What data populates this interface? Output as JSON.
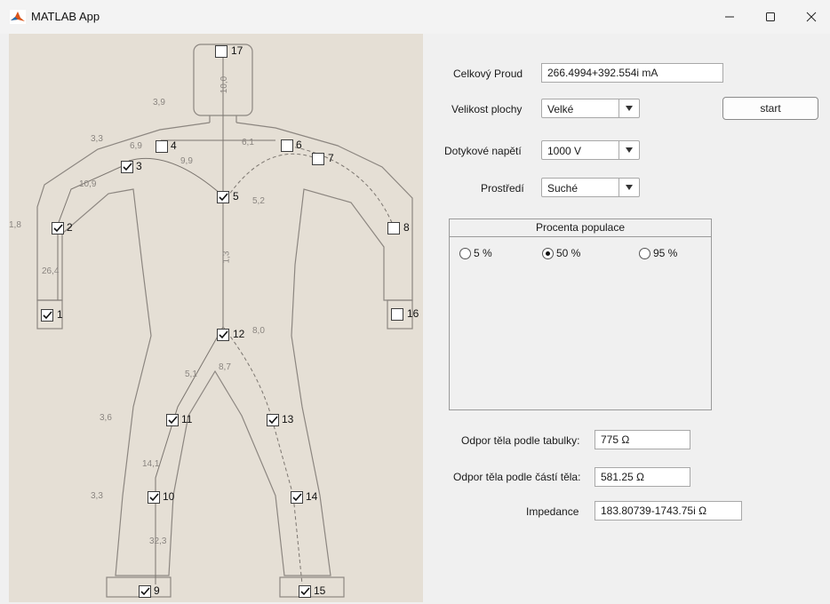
{
  "window": {
    "title": "MATLAB App",
    "minimize_icon": "minimize-icon",
    "maximize_icon": "maximize-icon",
    "close_icon": "close-icon"
  },
  "figure": {
    "checkboxes": [
      {
        "id": "1",
        "label": "1",
        "checked": true
      },
      {
        "id": "2",
        "label": "2",
        "checked": true
      },
      {
        "id": "3",
        "label": "3",
        "checked": true
      },
      {
        "id": "4",
        "label": "4",
        "checked": false
      },
      {
        "id": "5",
        "label": "5",
        "checked": true
      },
      {
        "id": "6",
        "label": "6",
        "checked": false
      },
      {
        "id": "7",
        "label": "7",
        "checked": false
      },
      {
        "id": "8",
        "label": "8",
        "checked": false
      },
      {
        "id": "9",
        "label": "9",
        "checked": true
      },
      {
        "id": "10",
        "label": "10",
        "checked": true
      },
      {
        "id": "11",
        "label": "11",
        "checked": true
      },
      {
        "id": "12",
        "label": "12",
        "checked": true
      },
      {
        "id": "13",
        "label": "13",
        "checked": true
      },
      {
        "id": "14",
        "label": "14",
        "checked": true
      },
      {
        "id": "15",
        "label": "15",
        "checked": true
      },
      {
        "id": "16",
        "label": "16",
        "checked": false
      },
      {
        "id": "17",
        "label": "17",
        "checked": false
      }
    ],
    "measurements": [
      "3,9",
      "3,3",
      "6,9",
      "6,1",
      "9,9",
      "10,9",
      "1,8",
      "26,4",
      "10,0",
      "5,2",
      "1,3",
      "8,0",
      "5,1",
      "8,7",
      "3,6",
      "14,1",
      "3,3",
      "32,3"
    ]
  },
  "form": {
    "current_label": "Celkový Proud",
    "current_value": "266.4994+392.554i mA",
    "area_label": "Velikost plochy",
    "area_value": "Velké",
    "start_label": "start",
    "voltage_label": "Dotykové napětí",
    "voltage_value": "1000 V",
    "environment_label": "Prostředí",
    "environment_value": "Suché",
    "population": {
      "title": "Procenta populace",
      "options": [
        {
          "label": "5 %",
          "selected": false
        },
        {
          "label": "50 %",
          "selected": true
        },
        {
          "label": "95 %",
          "selected": false
        }
      ]
    },
    "resistance_table_label": "Odpor těla podle tabulky:",
    "resistance_table_value": "775 Ω",
    "resistance_parts_label": "Odpor těla podle částí těla:",
    "resistance_parts_value": "581.25 Ω",
    "impedance_label": "Impedance",
    "impedance_value": "183.80739-1743.75i Ω"
  },
  "colors": {
    "matlab_icon": "#d9541a",
    "figure_bg": "#e5dfd5",
    "outline": "#8c8680"
  }
}
